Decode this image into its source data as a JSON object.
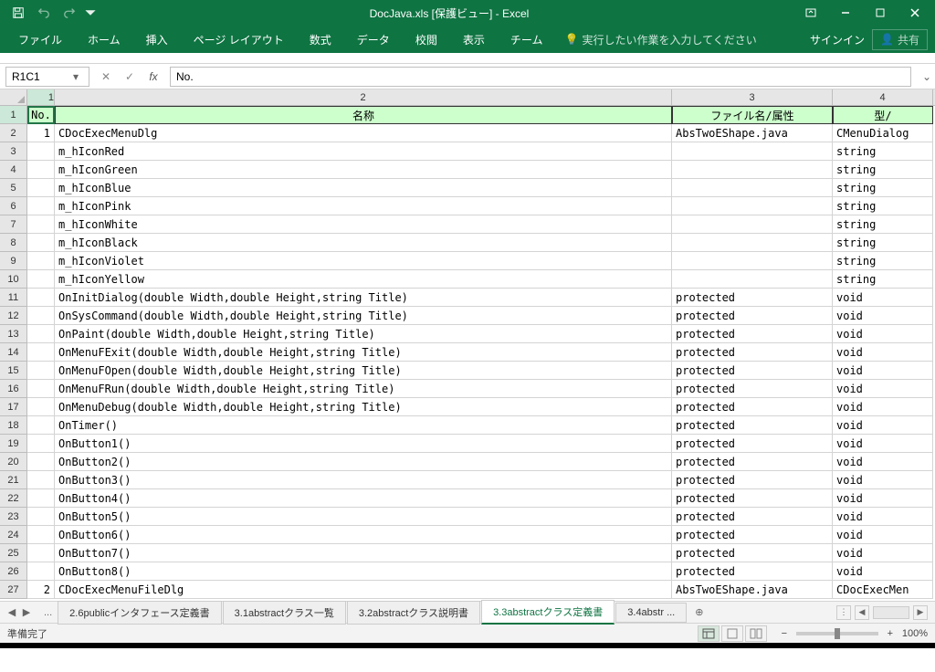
{
  "title": "DocJava.xls  [保護ビュー] - Excel",
  "ribbon": {
    "file": "ファイル",
    "home": "ホーム",
    "insert": "挿入",
    "pagelayout": "ページ レイアウト",
    "formulas": "数式",
    "data": "データ",
    "review": "校閲",
    "view": "表示",
    "team": "チーム",
    "tellme": "実行したい作業を入力してください",
    "signin": "サインイン",
    "share": "共有"
  },
  "nameBox": "R1C1",
  "formula": "No.",
  "colNums": [
    "1",
    "2",
    "3",
    "4"
  ],
  "headers": {
    "no": "No.",
    "name": "名称",
    "file": "ファイル名/属性",
    "type": "型/"
  },
  "rows": [
    {
      "no": "1",
      "name": "CDocExecMenuDlg",
      "file": "AbsTwoEShape.java",
      "type": "CMenuDialog"
    },
    {
      "no": "",
      "name": "m_hIconRed",
      "file": "",
      "type": "string"
    },
    {
      "no": "",
      "name": "m_hIconGreen",
      "file": "",
      "type": "string"
    },
    {
      "no": "",
      "name": "m_hIconBlue",
      "file": "",
      "type": "string"
    },
    {
      "no": "",
      "name": "m_hIconPink",
      "file": "",
      "type": "string"
    },
    {
      "no": "",
      "name": "m_hIconWhite",
      "file": "",
      "type": "string"
    },
    {
      "no": "",
      "name": "m_hIconBlack",
      "file": "",
      "type": "string"
    },
    {
      "no": "",
      "name": "m_hIconViolet",
      "file": "",
      "type": "string"
    },
    {
      "no": "",
      "name": "m_hIconYellow",
      "file": "",
      "type": "string"
    },
    {
      "no": "",
      "name": "OnInitDialog(double Width,double Height,string Title)",
      "file": "protected",
      "type": "void"
    },
    {
      "no": "",
      "name": "OnSysCommand(double Width,double Height,string Title)",
      "file": "protected",
      "type": "void"
    },
    {
      "no": "",
      "name": "OnPaint(double Width,double Height,string Title)",
      "file": "protected",
      "type": "void"
    },
    {
      "no": "",
      "name": "OnMenuFExit(double Width,double Height,string Title)",
      "file": "protected",
      "type": "void"
    },
    {
      "no": "",
      "name": "OnMenuFOpen(double Width,double Height,string Title)",
      "file": "protected",
      "type": "void"
    },
    {
      "no": "",
      "name": "OnMenuFRun(double Width,double Height,string Title)",
      "file": "protected",
      "type": "void"
    },
    {
      "no": "",
      "name": "OnMenuDebug(double Width,double Height,string Title)",
      "file": "protected",
      "type": "void"
    },
    {
      "no": "",
      "name": "OnTimer()",
      "file": "protected",
      "type": "void"
    },
    {
      "no": "",
      "name": "OnButton1()",
      "file": "protected",
      "type": "void"
    },
    {
      "no": "",
      "name": "OnButton2()",
      "file": "protected",
      "type": "void"
    },
    {
      "no": "",
      "name": "OnButton3()",
      "file": "protected",
      "type": "void"
    },
    {
      "no": "",
      "name": "OnButton4()",
      "file": "protected",
      "type": "void"
    },
    {
      "no": "",
      "name": "OnButton5()",
      "file": "protected",
      "type": "void"
    },
    {
      "no": "",
      "name": "OnButton6()",
      "file": "protected",
      "type": "void"
    },
    {
      "no": "",
      "name": "OnButton7()",
      "file": "protected",
      "type": "void"
    },
    {
      "no": "",
      "name": "OnButton8()",
      "file": "protected",
      "type": "void"
    },
    {
      "no": "2",
      "name": "CDocExecMenuFileDlg",
      "file": "AbsTwoEShape.java",
      "type": "CDocExecMen"
    }
  ],
  "sheets": {
    "ellipsis": "...",
    "s1": "2.6publicインタフェース定義書",
    "s2": "3.1abstractクラス一覧",
    "s3": "3.2abstractクラス説明書",
    "s4": "3.3abstractクラス定義書",
    "s5": "3.4abstr ..."
  },
  "status": "準備完了",
  "zoom": "100%"
}
